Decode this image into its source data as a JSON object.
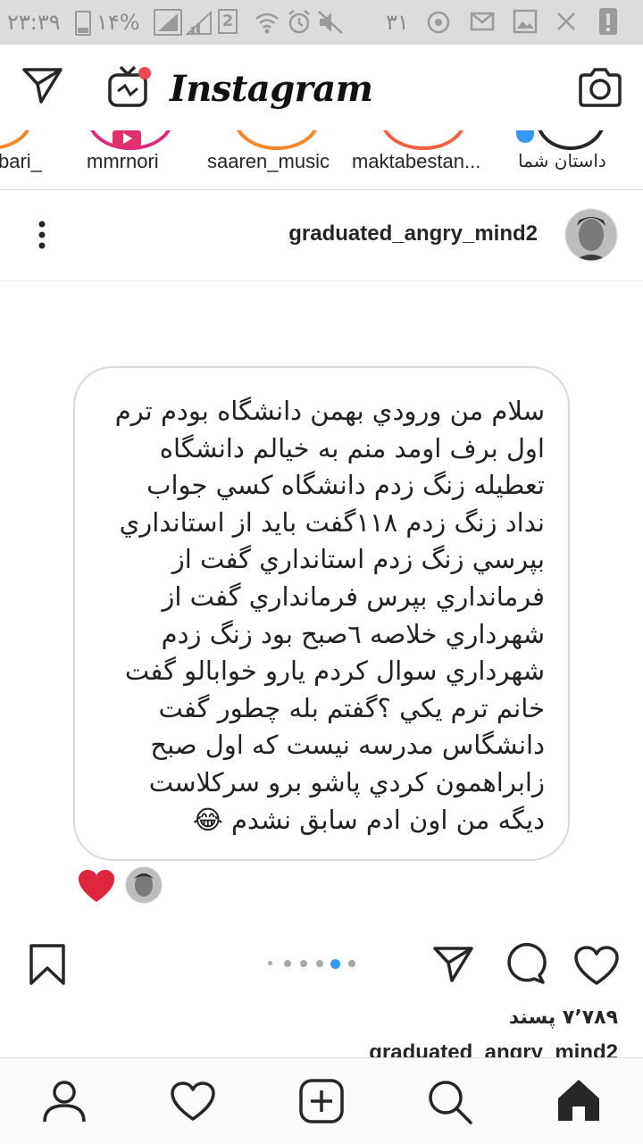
{
  "status_bar": {
    "time": "۲۳:۳۹",
    "battery": "۱۴%",
    "sim_slot": "2",
    "date_day": "۳۱"
  },
  "header": {
    "logo": "Instagram"
  },
  "stories": [
    {
      "name": "bari_"
    },
    {
      "name": "mmrnori"
    },
    {
      "name": "saaren_music"
    },
    {
      "name": "maktabestan..."
    },
    {
      "name": "داستان شما"
    }
  ],
  "post": {
    "username": "graduated_angry_mind2",
    "image_text": "سلام من ورودي بهمن دانشگاه بودم ترم\nاول برف اومد منم به خيالم دانشگاه\nتعطيله زنگ زدم دانشگاه کسي جواب\nنداد زنگ زدم ۱۱۸گفت بايد از استانداري\nبپرسي زنگ زدم استانداري گفت از\nفرمانداري بپرس فرمانداري گفت از\nشهرداري خلاصه ٦صبح بود زنگ زدم\nشهرداري سوال کردم يارو خوابالو گفت\nخانم ترم يکي ؟گفتم بله چطور گفت\nدانشگاس مدرسه نيست که اول صبح\nزابراهمون کردي پاشو برو سرکلاست\nديگه من اون ادم سابق نشدم",
    "emoji": "😂",
    "carousel_active_index": 4,
    "carousel_count": 6,
    "likes": "۷٬۷۸۹ پسند",
    "caption_username": "graduated_angry_mind2"
  },
  "colors": {
    "like_red": "#ed4956",
    "dot_active": "#3897f0",
    "dot_inactive": "#a8a8a8"
  }
}
